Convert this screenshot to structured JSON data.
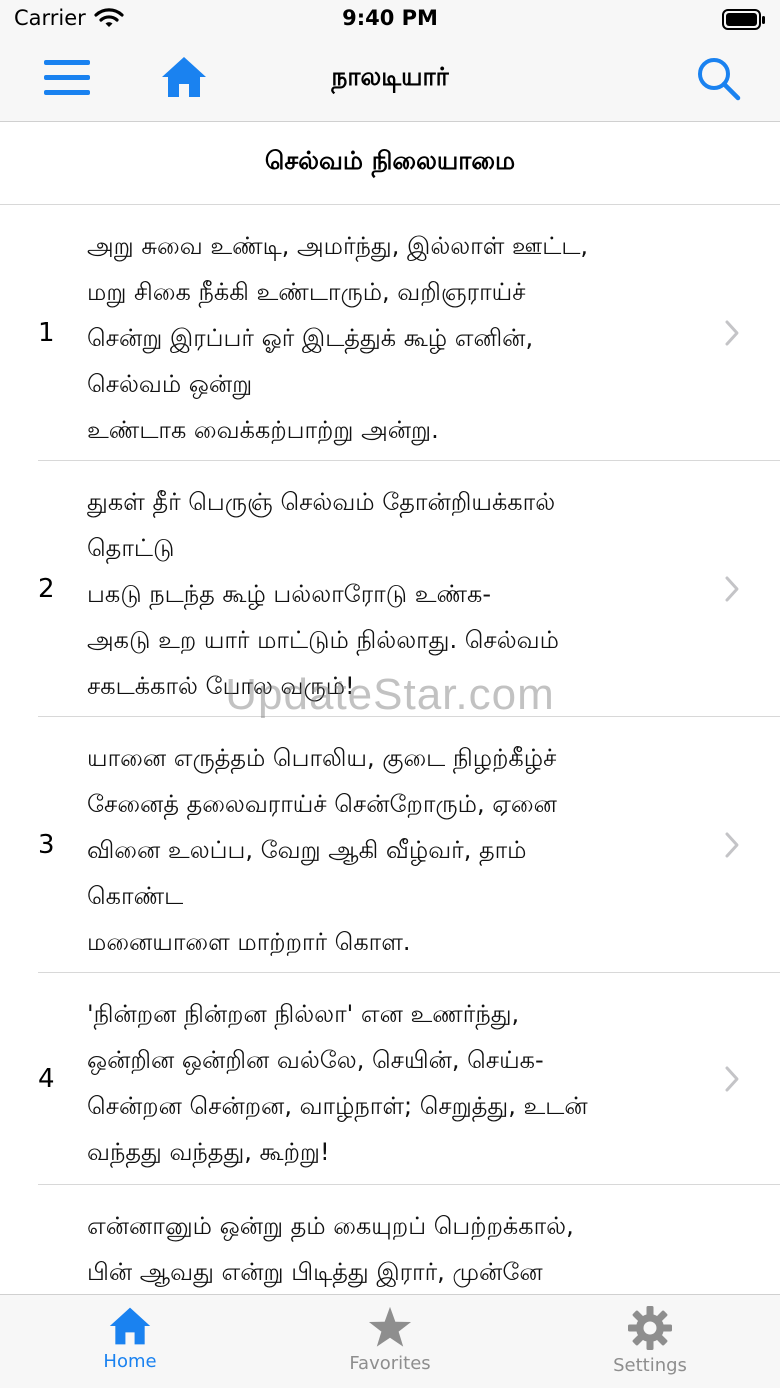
{
  "status_bar": {
    "carrier": "Carrier",
    "time": "9:40 PM"
  },
  "nav": {
    "title": "நாலடியார்",
    "menu_icon": "hamburger-menu-icon",
    "home_icon": "house-icon",
    "search_icon": "magnifier-icon"
  },
  "section": {
    "title": "செல்வம் நிலையாமை"
  },
  "verses": [
    {
      "number": "1",
      "lines": [
        "அறு சுவை உண்டி, அமர்ந்து, இல்லாள் ஊட்ட,",
        "மறு சிகை நீக்கி உண்டாரும், வறிஞராய்ச்",
        "சென்று இரப்பர் ஓர் இடத்துக் கூழ் எனின்,",
        "செல்வம் ஒன்று",
        "உண்டாக வைக்கற்பாற்று அன்று."
      ]
    },
    {
      "number": "2",
      "lines": [
        "துகள் தீர் பெருஞ் செல்வம் தோன்றியக்கால்",
        "தொட்டு",
        "பகடு நடந்த கூழ் பல்லாரோடு உண்க-",
        "அகடு உற யார் மாட்டும் நில்லாது. செல்வம்",
        "சகடக்கால் போல வரும்!"
      ]
    },
    {
      "number": "3",
      "lines": [
        "யானை எருத்தம் பொலிய, குடை நிழற்கீழ்ச்",
        "சேனைத் தலைவராய்ச் சென்றோரும், ஏனை",
        "வினை உலப்ப, வேறு ஆகி வீழ்வர், தாம்",
        "கொண்ட",
        "மனையாளை மாற்றார் கொள."
      ]
    },
    {
      "number": "4",
      "lines": [
        "'நின்றன நின்றன நில்லா' என உணர்ந்து,",
        "ஒன்றின ஒன்றின வல்லே, செயின், செய்க-",
        "சென்றன சென்றன, வாழ்நாள்; செறுத்து, உடன்",
        "வந்தது வந்தது, கூற்று!"
      ]
    },
    {
      "number": "",
      "lines": [
        "என்னானும் ஒன்று தம் கையுறப் பெற்றக்கால்,",
        "பின் ஆவது என்று பிடித்து இரார், முன்னே"
      ]
    }
  ],
  "watermark": "UpdateStar.com",
  "tabs": [
    {
      "label": "Home",
      "icon": "house-icon",
      "active": true
    },
    {
      "label": "Favorites",
      "icon": "star-icon",
      "active": false
    },
    {
      "label": "Settings",
      "icon": "gear-icon",
      "active": false
    }
  ],
  "colors": {
    "accent": "#1a82f0",
    "inactive": "#8e8e8e",
    "bar_bg": "#f7f7f7"
  }
}
